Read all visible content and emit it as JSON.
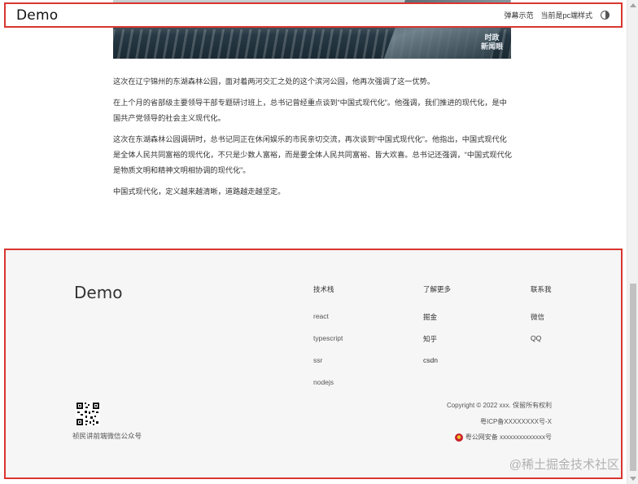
{
  "header": {
    "logo": "Demo",
    "nav": [
      "弹幕示范",
      "当前是pc端样式"
    ],
    "theme_icon": "half-moon-icon"
  },
  "hero": {
    "mark_line1": "时政",
    "mark_line2": "新闻眼"
  },
  "article": {
    "paragraphs": [
      "这次在辽宁锦州的东湖森林公园，面对着两河交汇之处的这个滨河公园，他再次强调了这一优势。",
      "在上个月的省部级主要领导干部专题研讨班上，总书记曾经重点谈到“中国式现代化”。他强调，我们推进的现代化，是中国共产党领导的社会主义现代化。",
      "这次在东湖森林公园调研时，总书记同正在休闲娱乐的市民亲切交流，再次谈到“中国式现代化”。他指出，中国式现代化是全体人民共同富裕的现代化，不只是少数人富裕，而是要全体人民共同富裕、皆大欢喜。总书记还强调，“中国式现代化是物质文明和精神文明相协调的现代化”。",
      "中国式现代化，定义越来越清晰，道路越走越坚定。"
    ]
  },
  "footer": {
    "logo": "Demo",
    "columns": [
      {
        "title": "技术栈",
        "links": [
          "react",
          "typescript",
          "ssr",
          "nodejs"
        ]
      },
      {
        "title": "了解更多",
        "links": [
          "掘金",
          "知乎",
          "csdn"
        ]
      },
      {
        "title": "联系我",
        "links": [
          "微信",
          "QQ"
        ]
      }
    ],
    "qr_caption": "祯民讲前端微信公众号",
    "copyright": "Copyright © 2022 xxx. 保留所有权利",
    "icp": "粤ICP备XXXXXXXX号-X",
    "police": "粤公网安备 xxxxxxxxxxxxxx号"
  },
  "watermark": "@稀土掘金技术社区",
  "colors": {
    "highlight_border": "#d9362f",
    "footer_bg": "#f6f6f6"
  }
}
